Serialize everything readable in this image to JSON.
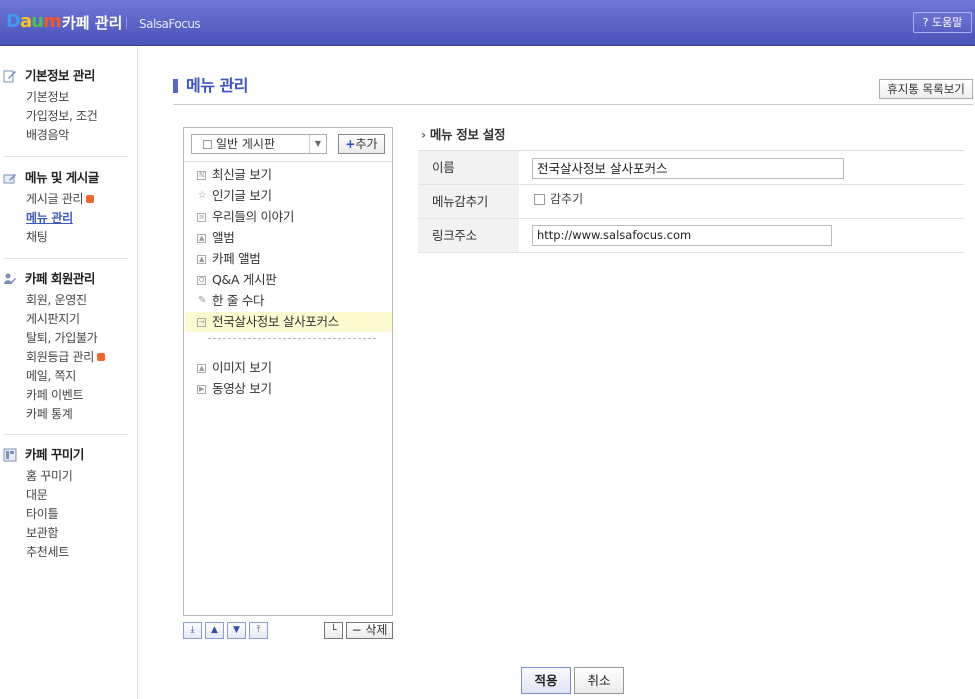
{
  "header": {
    "logo": [
      "D",
      "a",
      "u",
      "m"
    ],
    "logo_colors": [
      "#3d9bf0",
      "#f9c31b",
      "#4cc35a",
      "#f15a24"
    ],
    "title": "카페 관리",
    "cafe_name": "SalsaFocus",
    "help_label": "? 도움말"
  },
  "sidebar": {
    "sections": [
      {
        "title": "기본정보 관리",
        "icon": "edit-icon",
        "items": [
          "기본정보",
          "가입정보, 조건",
          "배경음악"
        ]
      },
      {
        "title": "메뉴 및 게시글",
        "icon": "folder-edit-icon",
        "items": [
          "게시글 관리",
          "메뉴 관리",
          "채팅"
        ],
        "new_badge_item": 0,
        "active_item": 1
      },
      {
        "title": "카페 회원관리",
        "icon": "members-icon",
        "items": [
          "회원, 운영진",
          "게시판지기",
          "탈퇴, 가입불가",
          "회원등급 관리",
          "메일, 쪽지",
          "카페 이벤트",
          "카페 통계"
        ],
        "new_badge_item": 3
      },
      {
        "title": "카페 꾸미기",
        "icon": "layout-icon",
        "items": [
          "홈 꾸미기",
          "대문",
          "타이틀",
          "보관함",
          "추천세트"
        ]
      }
    ]
  },
  "main": {
    "title": "메뉴 관리",
    "trash_button": "휴지통 목록보기"
  },
  "tree": {
    "board_type": "일반 게시판",
    "add_label": "추가",
    "items": [
      {
        "label": "최신글 보기",
        "icon": "new-post-icon"
      },
      {
        "label": "인기글 보기",
        "icon": "star-icon"
      },
      {
        "label": "우리들의 이야기",
        "icon": "board-icon"
      },
      {
        "label": "앨범",
        "icon": "album-icon"
      },
      {
        "label": "카페 앨범",
        "icon": "album-icon"
      },
      {
        "label": "Q&A 게시판",
        "icon": "qna-icon"
      },
      {
        "label": "한 줄 수다",
        "icon": "pencil-icon"
      },
      {
        "label": "전국살사정보 살사포커스",
        "icon": "link-icon",
        "selected": true
      }
    ],
    "extra_items": [
      {
        "label": "이미지 보기",
        "icon": "image-icon"
      },
      {
        "label": "동영상 보기",
        "icon": "video-icon"
      }
    ],
    "delete_label": "삭제"
  },
  "info": {
    "heading": "메뉴 정보 설정",
    "name_label": "이름",
    "name_value": "전국살사정보 살사포커스",
    "hide_label": "메뉴감추기",
    "hide_checkbox_label": "감추기",
    "link_label": "링크주소",
    "link_value": "http://www.salsafocus.com"
  },
  "footer": {
    "apply_label": "적용",
    "cancel_label": "취소"
  }
}
